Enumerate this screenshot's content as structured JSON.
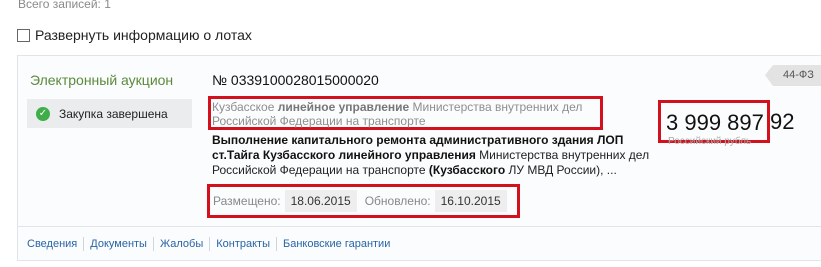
{
  "total": "Всего записей: 1",
  "expand_label": "Развернуть информацию о лотах",
  "card": {
    "procedure_type": "Электронный аукцион",
    "status": "Закупка завершена",
    "number": "№ 0339100028015000020",
    "law": "44-ФЗ",
    "org_pre": "Кузбасское ",
    "org_bold": "линейное управление",
    "org_post": " Министерства внутренних дел Российской Федерации на транспорте",
    "subject_b1": "Выполнение капитального ремонта административного здания ЛОП ст.Тайга Кузбасского линейного управления",
    "subject_t1": " Министерства внутренних дел Российской Федерации на транспорте ",
    "subject_b2": "(Кузбасского",
    "subject_t2": " ЛУ МВД России), ...",
    "price": "3 999 897",
    "price_kopecks": "92",
    "currency": "Российский рубль",
    "posted_label": "Размещено:",
    "posted_date": "18.06.2015",
    "updated_label": "Обновлено:",
    "updated_date": "16.10.2015",
    "tabs": [
      "Сведения",
      "Документы",
      "Жалобы",
      "Контракты",
      "Банковские гарантии"
    ]
  },
  "colors": {
    "accent_link": "#2864a6",
    "highlight_border": "#d3111c",
    "success": "#3fae49",
    "procedure_green": "#5b8a3a"
  }
}
